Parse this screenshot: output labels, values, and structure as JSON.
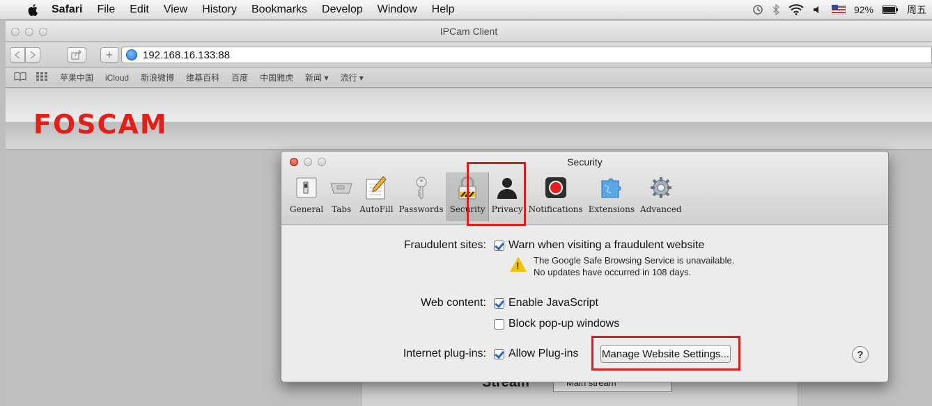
{
  "menubar": {
    "app": "Safari",
    "items": [
      "File",
      "Edit",
      "View",
      "History",
      "Bookmarks",
      "Develop",
      "Window",
      "Help"
    ],
    "battery": "92%",
    "day": "周五"
  },
  "window": {
    "title": "IPCam Client"
  },
  "toolbar": {
    "url": "192.168.16.133:88"
  },
  "bookmarks": [
    "苹果中国",
    "iCloud",
    "新浪微博",
    "维基百科",
    "百度",
    "中国雅虎",
    "新闻 ▾",
    "流行 ▾"
  ],
  "page": {
    "logo": "FOSCAM",
    "stream_label": "Stream",
    "stream_value": "Main stream"
  },
  "dialog": {
    "title": "Security",
    "tabs": [
      {
        "label": "General",
        "icon": "general-switch-icon"
      },
      {
        "label": "Tabs",
        "icon": "tabs-icon"
      },
      {
        "label": "AutoFill",
        "icon": "autofill-icon"
      },
      {
        "label": "Passwords",
        "icon": "key-icon"
      },
      {
        "label": "Security",
        "icon": "lock-icon"
      },
      {
        "label": "Privacy",
        "icon": "person-icon"
      },
      {
        "label": "Notifications",
        "icon": "notification-icon"
      },
      {
        "label": "Extensions",
        "icon": "puzzle-icon"
      },
      {
        "label": "Advanced",
        "icon": "gear-icon"
      }
    ],
    "selected_tab": "Security",
    "fraud_label": "Fraudulent sites:",
    "fraud_option": "Warn when visiting a fraudulent website",
    "fraud_note1": "The Google Safe Browsing Service is unavailable.",
    "fraud_note2": "No updates have occurred in 108 days.",
    "web_label": "Web content:",
    "js_option": "Enable JavaScript",
    "popup_option": "Block pop-up windows",
    "plugins_label": "Internet plug-ins:",
    "plugins_option": "Allow Plug-ins",
    "manage_button": "Manage Website Settings...",
    "help": "?"
  },
  "colors": {
    "highlight": "#d62020",
    "logo": "#e0201b"
  }
}
